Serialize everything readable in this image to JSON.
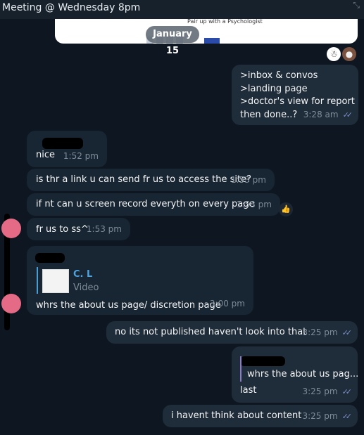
{
  "header": {
    "title": "Meeting @ Wednesday 8pm",
    "corner_icon": "⤡"
  },
  "link_preview": {
    "text": "Pair up with a Psychologist"
  },
  "date_divider": "January 15",
  "reactions": [
    "☃",
    "●"
  ],
  "messages": {
    "m1": {
      "lines": [
        ">inbox & convos",
        ">landing page",
        ">doctor's view for report",
        "then done..?"
      ],
      "time": "3:28 am"
    },
    "m2": {
      "text": "nice",
      "time": "1:52 pm"
    },
    "m3": {
      "text": "is thr a link u can send fr us to access the site?",
      "time": "1:53 pm"
    },
    "m4": {
      "text": "if nt can u screen record everyth on every page",
      "time": "1:53 pm",
      "reaction": "👍"
    },
    "m5": {
      "text": "fr us to ss^",
      "time": "1:53 pm"
    },
    "m6": {
      "quote_name": "C. L",
      "quote_sub": "Video",
      "text": "whrs the about us page/ discretion page",
      "time": "3:00 pm"
    },
    "m7": {
      "text": "no its not published haven't look into that",
      "time": "3:25 pm"
    },
    "m8": {
      "quote_text": "whrs the about us pag...",
      "text": "last",
      "time": "3:25 pm"
    },
    "m9": {
      "text": "i havent think about content",
      "time": "3:25 pm"
    }
  },
  "colors": {
    "background": "#0e1621",
    "bubble_in": "#182533",
    "bubble_out": "#1f2c3a",
    "read_ticks": "#7c8ec9",
    "quote_accent": "#4fa3df",
    "avatar": "#e56a86"
  }
}
